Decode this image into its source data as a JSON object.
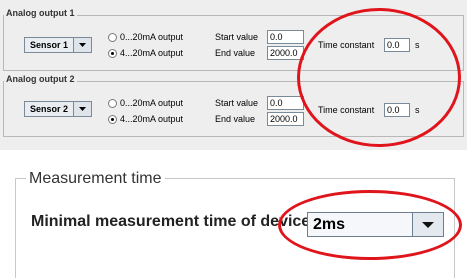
{
  "analog_output_1": {
    "title": "Analog output 1",
    "sensor": "Sensor 1",
    "options": [
      "0...20mA output",
      "4...20mA output"
    ],
    "selected_option": "4...20mA output",
    "start_label": "Start value",
    "start_value": "0.0",
    "end_label": "End value",
    "end_value": "2000.0",
    "time_constant_label": "Time constant",
    "time_constant_value": "0.0",
    "time_constant_unit": "s"
  },
  "analog_output_2": {
    "title": "Analog output 2",
    "sensor": "Sensor 2",
    "options": [
      "0...20mA output",
      "4...20mA output"
    ],
    "selected_option": "4...20mA output",
    "start_label": "Start value",
    "start_value": "0.0",
    "end_label": "End value",
    "end_value": "2000.0",
    "time_constant_label": "Time constant",
    "time_constant_value": "0.0",
    "time_constant_unit": "s"
  },
  "measurement_time": {
    "title": "Measurement time",
    "label": "Minimal measurement time of device",
    "value": "2ms"
  },
  "colors": {
    "highlight": "#e0141b",
    "panel_bg": "#eeeeee"
  },
  "icons": [
    "chevron-down-icon",
    "radio-button-icon"
  ]
}
